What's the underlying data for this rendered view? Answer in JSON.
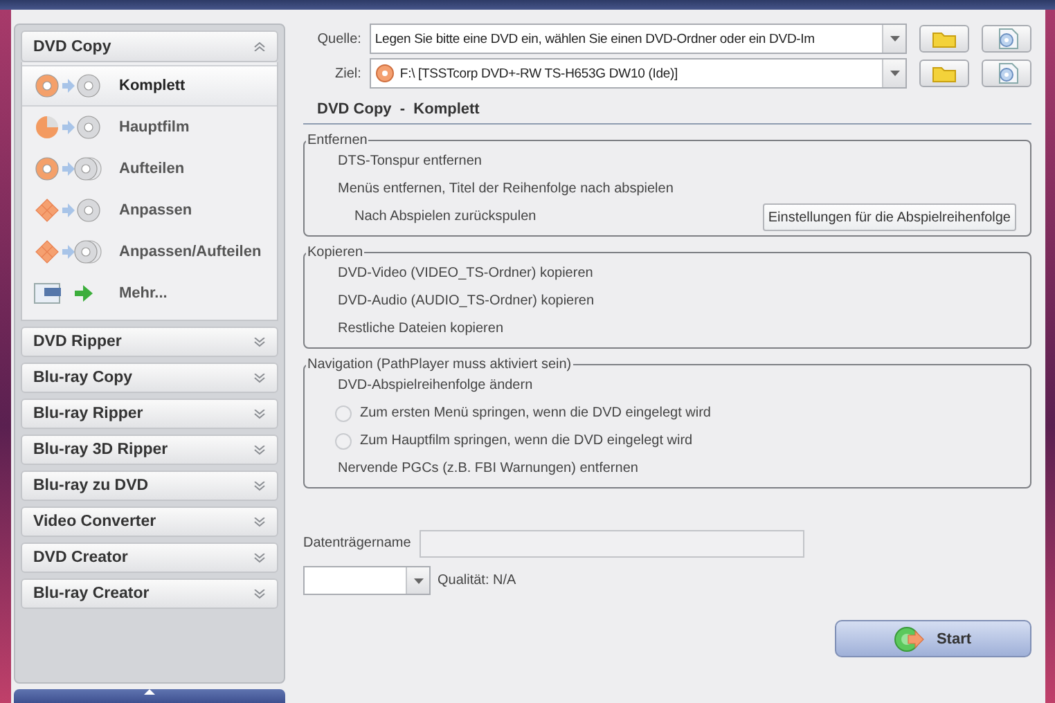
{
  "sidebar": {
    "sections": [
      {
        "title": "DVD Copy",
        "expanded": true,
        "items": [
          {
            "label": "Komplett",
            "kind": "full",
            "selected": true
          },
          {
            "label": "Hauptfilm",
            "kind": "main",
            "selected": false
          },
          {
            "label": "Aufteilen",
            "kind": "split",
            "selected": false
          },
          {
            "label": "Anpassen",
            "kind": "custom",
            "selected": false
          },
          {
            "label": "Anpassen/Aufteilen",
            "kind": "custom-split",
            "selected": false
          },
          {
            "label": "Mehr...",
            "kind": "more",
            "selected": false
          }
        ]
      },
      {
        "title": "DVD Ripper",
        "expanded": false
      },
      {
        "title": "Blu-ray Copy",
        "expanded": false
      },
      {
        "title": "Blu-ray Ripper",
        "expanded": false
      },
      {
        "title": "Blu-ray 3D Ripper",
        "expanded": false
      },
      {
        "title": "Blu-ray zu DVD",
        "expanded": false
      },
      {
        "title": "Video Converter",
        "expanded": false
      },
      {
        "title": "DVD Creator",
        "expanded": false
      },
      {
        "title": "Blu-ray Creator",
        "expanded": false
      }
    ]
  },
  "source": {
    "label": "Quelle:",
    "value": "Legen Sie bitte eine DVD ein, wählen Sie einen DVD-Ordner oder ein DVD-Im"
  },
  "target": {
    "label": "Ziel:",
    "value": "F:\\ [TSSTcorp DVD+-RW TS-H653G DW10 (Ide)]"
  },
  "mode_title": "DVD Copy  -  Komplett",
  "groups": [
    {
      "title": "Entfernen",
      "options": [
        {
          "kind": "text",
          "label": "DTS-Tonspur entfernen"
        },
        {
          "kind": "text",
          "label": "Menüs entfernen, Titel der Reihenfolge nach abspielen"
        },
        {
          "kind": "sub",
          "label": "Nach Abspielen zurückspulen",
          "button": "Einstellungen für die Abspielreihenfolge"
        }
      ]
    },
    {
      "title": "Kopieren",
      "options": [
        {
          "kind": "text",
          "label": "DVD-Video (VIDEO_TS-Ordner) kopieren"
        },
        {
          "kind": "text",
          "label": "DVD-Audio (AUDIO_TS-Ordner) kopieren"
        },
        {
          "kind": "text",
          "label": "Restliche Dateien kopieren"
        }
      ]
    },
    {
      "title": "Navigation (PathPlayer muss aktiviert sein)",
      "options": [
        {
          "kind": "text",
          "label": "DVD-Abspielreihenfolge ändern"
        },
        {
          "kind": "radio",
          "label": "Zum ersten Menü springen, wenn die DVD eingelegt wird",
          "selected": false
        },
        {
          "kind": "radio",
          "label": "Zum Hauptfilm springen, wenn die DVD eingelegt wird",
          "selected": false
        },
        {
          "kind": "text",
          "label": "Nervende PGCs (z.B. FBI Warnungen) entfernen"
        }
      ]
    }
  ],
  "volume_label": "Datenträgername",
  "quality": "Qualität: N/A",
  "start": "Start"
}
